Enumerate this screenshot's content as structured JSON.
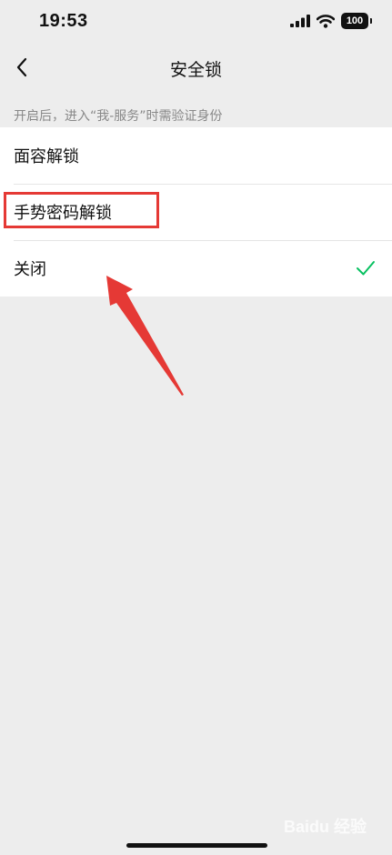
{
  "status_bar": {
    "time": "19:53",
    "battery_level": "100"
  },
  "nav": {
    "title": "安全锁",
    "back_icon": "chevron-left-icon"
  },
  "hint": "开启后，进入“我-服务”时需验证身份",
  "options": [
    {
      "label": "面容解锁",
      "selected": false
    },
    {
      "label": "手势密码解锁",
      "selected": false
    },
    {
      "label": "关闭",
      "selected": true
    }
  ],
  "check_icon": "checkmark-icon",
  "colors": {
    "accent_green": "#07c160",
    "annotation_red": "#e53935",
    "background": "#ededed"
  },
  "watermark": "Baidu 经验"
}
